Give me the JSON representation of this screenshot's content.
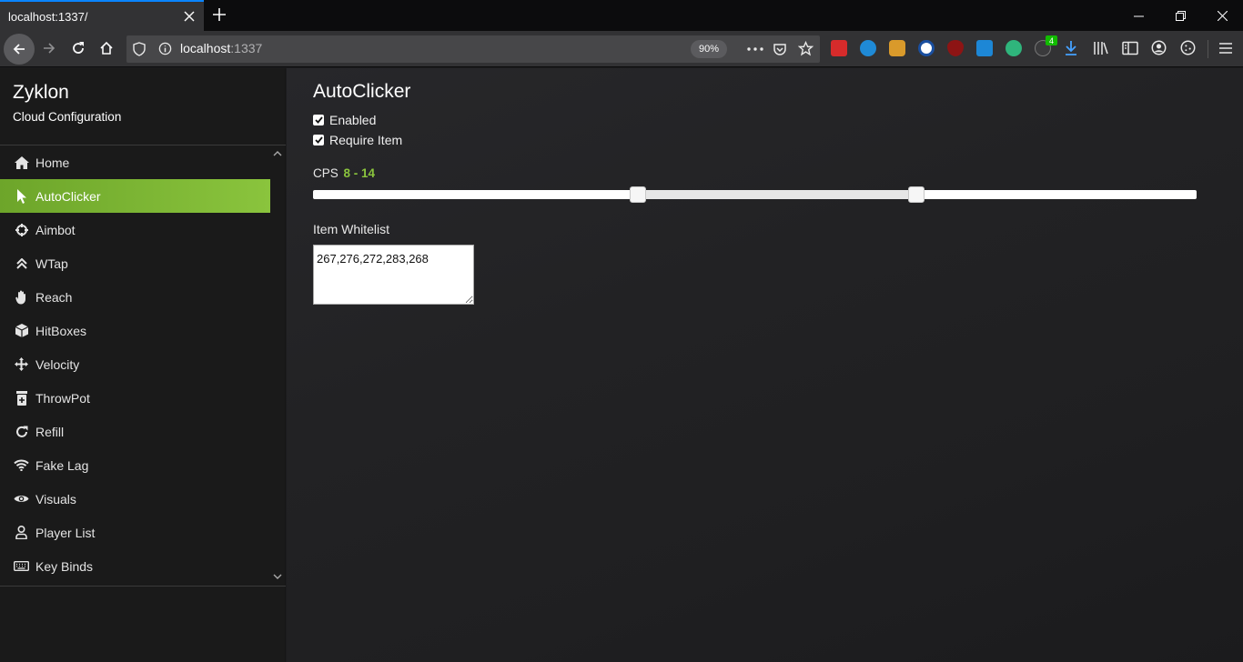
{
  "browser": {
    "tab_title": "localhost:1337/",
    "url_host": "localhost",
    "url_port": ":1337",
    "zoom": "90%",
    "ext_badge_count": "4"
  },
  "sidebar": {
    "brand_title": "Zyklon",
    "brand_subtitle": "Cloud Configuration",
    "items": [
      {
        "label": "Home",
        "icon": "home-icon"
      },
      {
        "label": "AutoClicker",
        "icon": "cursor-icon",
        "active": true
      },
      {
        "label": "Aimbot",
        "icon": "crosshair-icon"
      },
      {
        "label": "WTap",
        "icon": "double-chevron-up-icon"
      },
      {
        "label": "Reach",
        "icon": "hand-icon"
      },
      {
        "label": "HitBoxes",
        "icon": "cube-icon"
      },
      {
        "label": "Velocity",
        "icon": "arrows-move-icon"
      },
      {
        "label": "ThrowPot",
        "icon": "potion-icon"
      },
      {
        "label": "Refill",
        "icon": "refresh-icon"
      },
      {
        "label": "Fake Lag",
        "icon": "wifi-icon"
      },
      {
        "label": "Visuals",
        "icon": "eye-icon"
      },
      {
        "label": "Player List",
        "icon": "user-icon"
      },
      {
        "label": "Key Binds",
        "icon": "keyboard-icon"
      }
    ]
  },
  "main": {
    "title": "AutoClicker",
    "enabled_label": "Enabled",
    "enabled_checked": true,
    "require_item_label": "Require Item",
    "require_item_checked": true,
    "cps_label": "CPS",
    "cps_range": "8 - 14",
    "cps_min": 8,
    "cps_max": 14,
    "whitelist_label": "Item Whitelist",
    "whitelist_value": "267,276,272,283,268"
  },
  "colors": {
    "accent": "#8ac43d",
    "sidebar_bg": "#1a1a1a",
    "main_bg": "#232325"
  }
}
